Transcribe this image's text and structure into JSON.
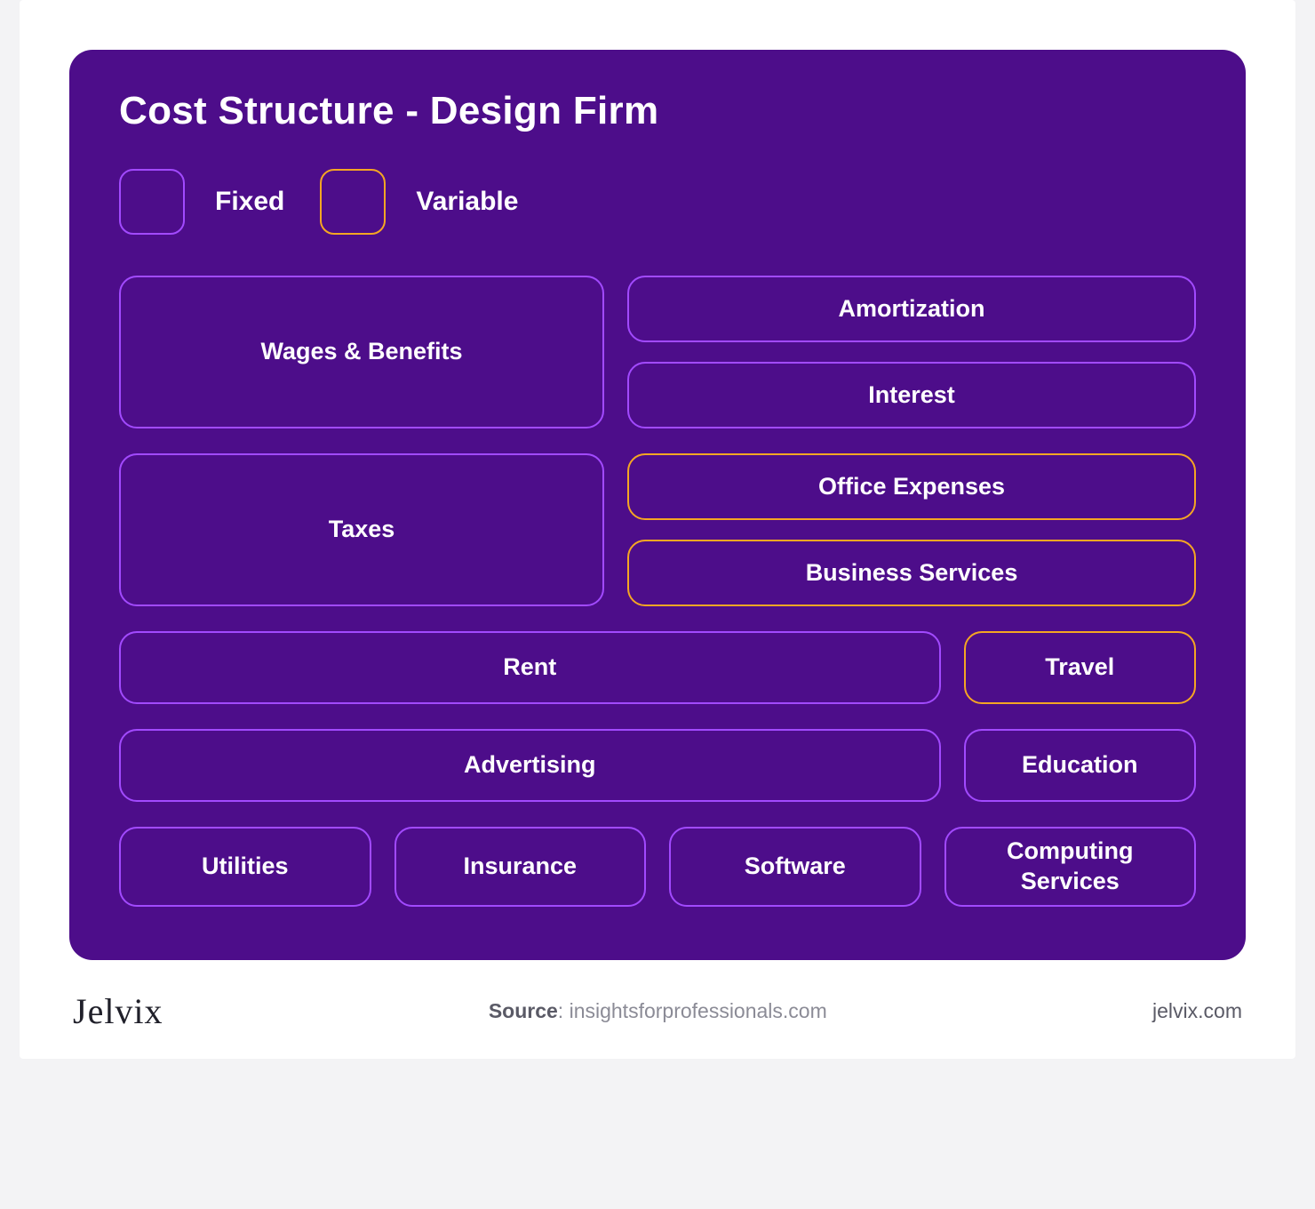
{
  "title": "Cost Structure - Design Firm",
  "legend": {
    "fixed_label": "Fixed",
    "variable_label": "Variable"
  },
  "colors": {
    "panel_bg": "#4d0d8a",
    "fixed_border": "#a24aff",
    "variable_border": "#f5a623"
  },
  "categories": {
    "wages_benefits": {
      "label": "Wages & Benefits",
      "type": "fixed"
    },
    "amortization": {
      "label": "Amortization",
      "type": "fixed"
    },
    "interest": {
      "label": "Interest",
      "type": "fixed"
    },
    "taxes": {
      "label": "Taxes",
      "type": "fixed"
    },
    "office_expenses": {
      "label": "Office Expenses",
      "type": "variable"
    },
    "business_services": {
      "label": "Business Services",
      "type": "variable"
    },
    "rent": {
      "label": "Rent",
      "type": "fixed"
    },
    "travel": {
      "label": "Travel",
      "type": "variable"
    },
    "advertising": {
      "label": "Advertising",
      "type": "fixed"
    },
    "education": {
      "label": "Education",
      "type": "fixed"
    },
    "utilities": {
      "label": "Utilities",
      "type": "fixed"
    },
    "insurance": {
      "label": "Insurance",
      "type": "fixed"
    },
    "software": {
      "label": "Software",
      "type": "fixed"
    },
    "computing_services": {
      "label": "Computing Services",
      "type": "fixed"
    }
  },
  "footer": {
    "brand": "Jelvix",
    "source_label": "Source",
    "source_value": "insightsforprofessionals.com",
    "site": "jelvix.com"
  }
}
